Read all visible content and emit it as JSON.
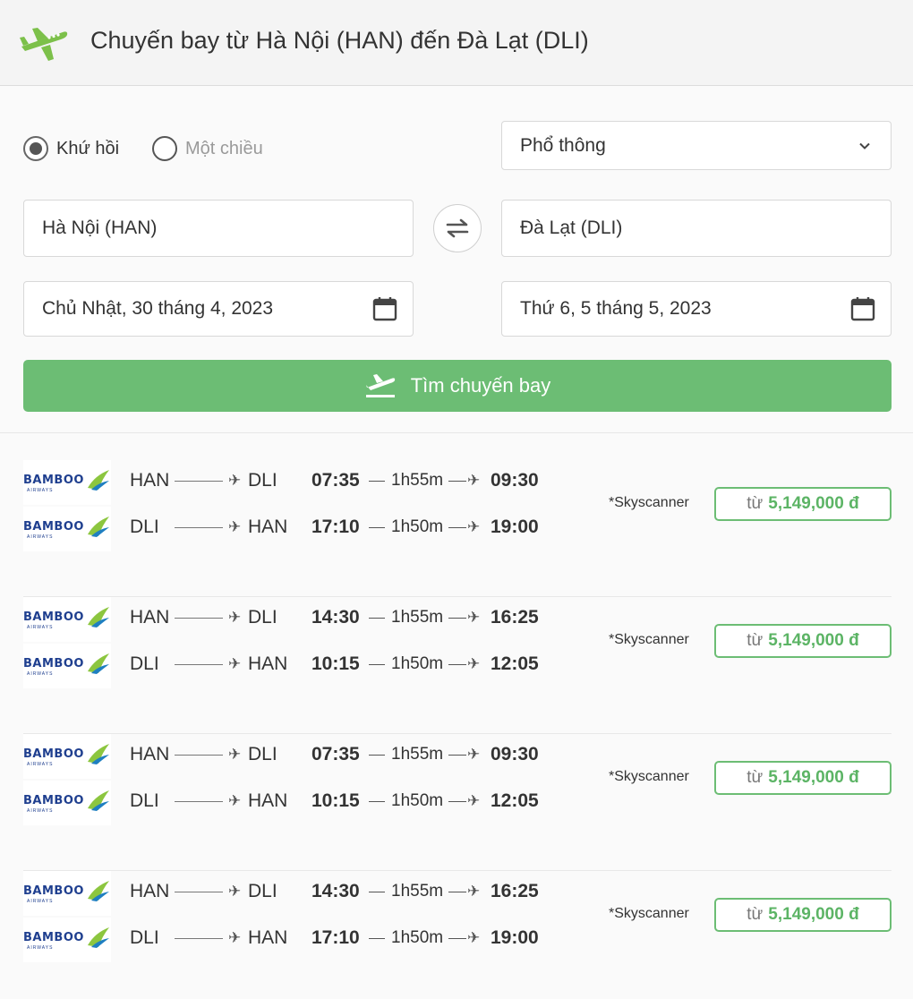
{
  "header": {
    "title": "Chuyến bay từ Hà Nội (HAN) đến Đà Lạt (DLI)",
    "icon": "airplane-icon"
  },
  "trip_type": {
    "round_trip": "Khứ hồi",
    "one_way": "Một chiều",
    "selected": "round_trip"
  },
  "cabin_class": {
    "value": "Phổ thông"
  },
  "origin": {
    "value": "Hà Nội (HAN)"
  },
  "destination": {
    "value": "Đà Lạt (DLI)"
  },
  "depart_date": {
    "value": "Chủ Nhật, 30 tháng 4, 2023"
  },
  "return_date": {
    "value": "Thứ 6, 5 tháng 5, 2023"
  },
  "search_button": {
    "label": "Tìm chuyến bay"
  },
  "colors": {
    "accent": "#6cbd74",
    "price_text": "#5cb465",
    "brand_blue": "#1f3f8f"
  },
  "results": [
    {
      "outbound": {
        "airline": "BAMBOO",
        "airline_sub": "AIRWAYS",
        "from": "HAN",
        "to": "DLI",
        "depart": "07:35",
        "duration": "1h55m",
        "arrive": "09:30"
      },
      "inbound": {
        "airline": "BAMBOO",
        "airline_sub": "AIRWAYS",
        "from": "DLI",
        "to": "HAN",
        "depart": "17:10",
        "duration": "1h50m",
        "arrive": "19:00"
      },
      "source": "*Skyscanner",
      "price_prefix": "từ",
      "price": "5,149,000 đ"
    },
    {
      "outbound": {
        "airline": "BAMBOO",
        "airline_sub": "AIRWAYS",
        "from": "HAN",
        "to": "DLI",
        "depart": "14:30",
        "duration": "1h55m",
        "arrive": "16:25"
      },
      "inbound": {
        "airline": "BAMBOO",
        "airline_sub": "AIRWAYS",
        "from": "DLI",
        "to": "HAN",
        "depart": "10:15",
        "duration": "1h50m",
        "arrive": "12:05"
      },
      "source": "*Skyscanner",
      "price_prefix": "từ",
      "price": "5,149,000 đ"
    },
    {
      "outbound": {
        "airline": "BAMBOO",
        "airline_sub": "AIRWAYS",
        "from": "HAN",
        "to": "DLI",
        "depart": "07:35",
        "duration": "1h55m",
        "arrive": "09:30"
      },
      "inbound": {
        "airline": "BAMBOO",
        "airline_sub": "AIRWAYS",
        "from": "DLI",
        "to": "HAN",
        "depart": "10:15",
        "duration": "1h50m",
        "arrive": "12:05"
      },
      "source": "*Skyscanner",
      "price_prefix": "từ",
      "price": "5,149,000 đ"
    },
    {
      "outbound": {
        "airline": "BAMBOO",
        "airline_sub": "AIRWAYS",
        "from": "HAN",
        "to": "DLI",
        "depart": "14:30",
        "duration": "1h55m",
        "arrive": "16:25"
      },
      "inbound": {
        "airline": "BAMBOO",
        "airline_sub": "AIRWAYS",
        "from": "DLI",
        "to": "HAN",
        "depart": "17:10",
        "duration": "1h50m",
        "arrive": "19:00"
      },
      "source": "*Skyscanner",
      "price_prefix": "từ",
      "price": "5,149,000 đ"
    }
  ]
}
